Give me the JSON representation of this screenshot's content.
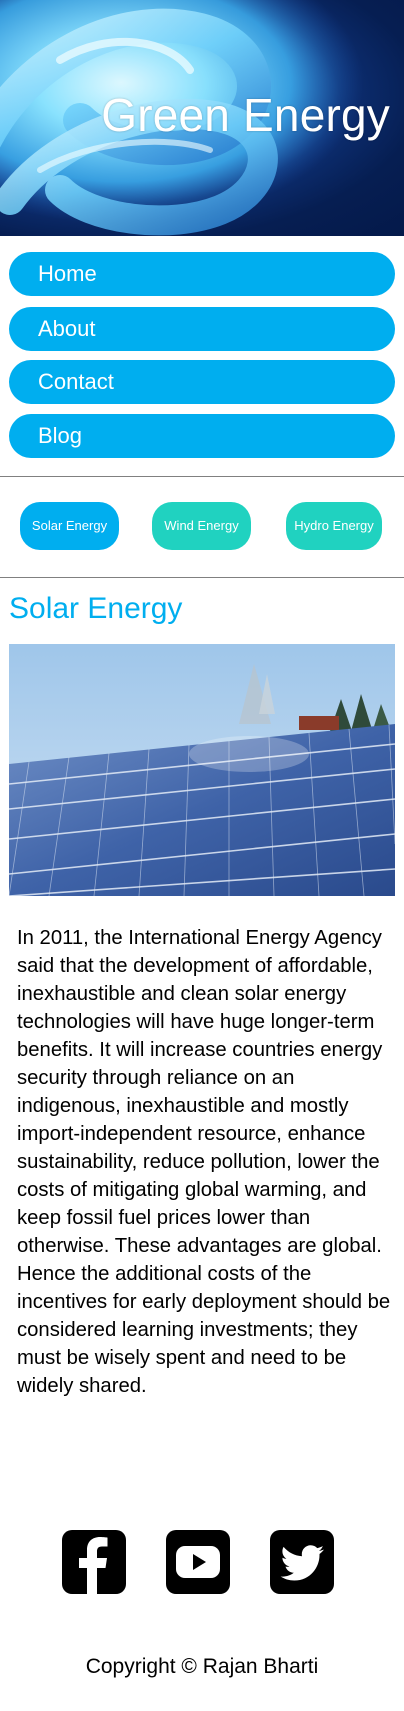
{
  "header": {
    "title": "Green Energy",
    "image": "energy-saving-bulb"
  },
  "nav": {
    "items": [
      {
        "label": "Home"
      },
      {
        "label": "About"
      },
      {
        "label": "Contact"
      },
      {
        "label": "Blog"
      }
    ]
  },
  "tabs": [
    {
      "label": "Solar Energy",
      "color": "#00aeef"
    },
    {
      "label": "Wind Energy",
      "color": "#20d2c0"
    },
    {
      "label": "Hydro Energy",
      "color": "#20d2c0"
    }
  ],
  "main": {
    "section_title": "Solar Energy",
    "image": "solar-panels",
    "paragraph": "In 2011, the International Energy Agency said that the development of affordable, inexhaustible and clean solar energy technologies will have huge longer-term benefits. It will increase countries energy security through reliance on an indigenous, inexhaustible and mostly import-independent resource, enhance sustainability, reduce pollution, lower the costs of mitigating global warming, and keep fossil fuel prices lower than otherwise. These advantages are global. Hence the additional costs of the incentives for early deployment should be considered learning investments; they must be wisely spent and need to be widely shared."
  },
  "social": [
    {
      "icon": "facebook-icon"
    },
    {
      "icon": "youtube-icon"
    },
    {
      "icon": "twitter-icon"
    }
  ],
  "footer": {
    "copyright": "Copyright © Rajan Bharti"
  },
  "colors": {
    "accent": "#00aeef",
    "secondary": "#20d2c0",
    "header_bg": "#061e52"
  }
}
